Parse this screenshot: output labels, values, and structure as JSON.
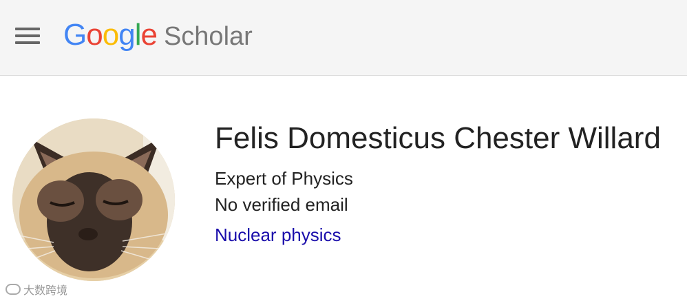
{
  "header": {
    "menu_icon": "hamburger-menu-icon",
    "logo": {
      "google_letters": [
        {
          "char": "G",
          "color": "#4285F4"
        },
        {
          "char": "o",
          "color": "#EA4335"
        },
        {
          "char": "o",
          "color": "#FBBC05"
        },
        {
          "char": "g",
          "color": "#4285F4"
        },
        {
          "char": "l",
          "color": "#34A853"
        },
        {
          "char": "e",
          "color": "#EA4335"
        }
      ],
      "product": "Scholar",
      "product_color": "#777777"
    },
    "background": "#f5f5f5"
  },
  "profile": {
    "avatar_icon": "siamese-cat-avatar",
    "name": "Felis Domesticus Chester Willard",
    "affiliation": "Expert of Physics",
    "email_status": "No verified email",
    "interests": [
      "Nuclear physics"
    ],
    "link_color": "#1a0dab"
  },
  "watermark": {
    "text": "大数跨境"
  }
}
